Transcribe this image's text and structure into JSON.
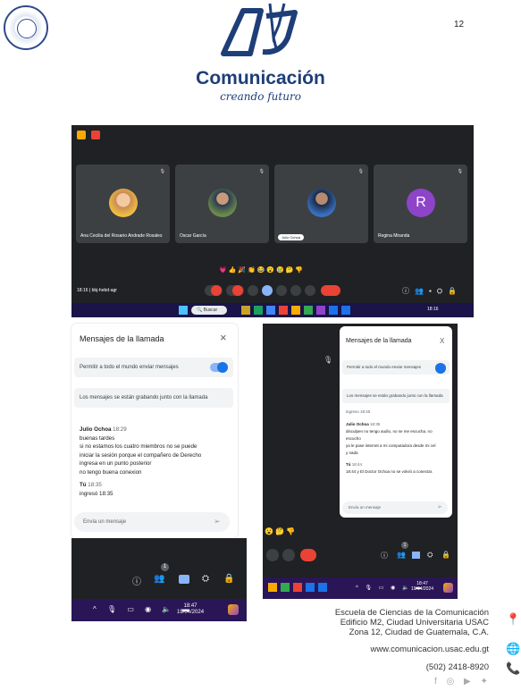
{
  "header": {
    "page_number": "12",
    "brand": "Comunicación",
    "tagline": "creando futuro"
  },
  "meet": {
    "participants": [
      {
        "name": "Ana Cecilia del Rosario Andrade Rosales"
      },
      {
        "name": "Oscar García"
      },
      {
        "name": "Julio Ochoa"
      },
      {
        "name": "Regina Miranda",
        "initial": "R"
      }
    ],
    "meeting_info": "18:16  |  bbj-hebd-agr",
    "reactions": "💗 👍 🎉 👏 😂 😮 😢 🤔 👎",
    "search_placeholder": "Buscar",
    "taskbar_clock": "18:16"
  },
  "chat_left": {
    "title": "Mensajes de la llamada",
    "allow_label": "Permitir a todo el mundo enviar mensajes",
    "recording_notice": "Los mensajes se están grabando junto con la llamada",
    "msg1_author": "Julio Ochoa",
    "msg1_time": "18:29",
    "msg1_lines": [
      "buenas tardes",
      "si no estamos los cuatro miembros no se puede",
      "iniciar la sesión porque el compañero de Derecho",
      "ingresa en un punto posterior",
      "no tengo buena conexion"
    ],
    "msg2_author": "Tú",
    "msg2_time": "18:35",
    "msg2_line": "ingresó 18:35",
    "input_placeholder": "Envía un mensaje",
    "participant_count": "1",
    "taskbar_time": "18:47",
    "taskbar_date": "19/04/2024"
  },
  "chat_right": {
    "title": "Mensajes de la llamada",
    "allow_label": "Permitir a todo el mundo enviar mensajes",
    "recording_notice": "Los mensajes se están grabando junto con la llamada",
    "prev_line": "ingreso 18:40",
    "msg1_author": "Julio Ochoa",
    "msg1_time": "18:35",
    "msg1_lines": [
      "disculpen no tengo audio, no se me escucha, no",
      "escucho",
      "ya le pase internet a mi computadora desde mi cel",
      "y nada"
    ],
    "msg2_author": "Tú",
    "msg2_time": "18:44",
    "msg2_line": "18:44 y El Doctor Ochoa no se volvió a conectar.",
    "input_placeholder": "Envía un mensaje",
    "participant_count": "1",
    "reactions": "😮 🤔 👎",
    "taskbar_time": "18:47",
    "taskbar_date": "19/04/2024"
  },
  "footer": {
    "line1": "Escuela de Ciencias de la Comunicación",
    "line2": "Edificio M2, Ciudad Universitaria USAC",
    "line3": "Zona 12, Ciudad de Guatemala, C.A.",
    "website": "www.comunicacion.usac.edu.gt",
    "phone": "(502) 2418-8920"
  },
  "colors": {
    "brand_blue": "#1e3e78",
    "meet_dark": "#202124",
    "google_blue": "#1a73e8",
    "hangup_red": "#ea4335"
  }
}
